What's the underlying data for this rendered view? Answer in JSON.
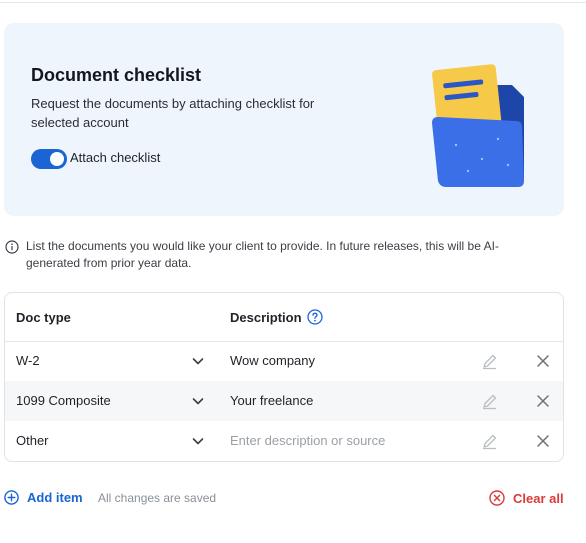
{
  "hero": {
    "title": "Document checklist",
    "description": "Request the documents by attaching checklist for selected account",
    "toggle_label": "Attach checklist",
    "toggle_on": true
  },
  "info": {
    "text": "List the documents you would like your client to provide. In future releases, this will be AI-generated from prior year data."
  },
  "table": {
    "headers": {
      "doc_type": "Doc type",
      "description": "Description"
    },
    "rows": [
      {
        "doc_type": "W-2",
        "description": "Wow company",
        "placeholder": ""
      },
      {
        "doc_type": "1099 Composite",
        "description": "Your freelance",
        "placeholder": ""
      },
      {
        "doc_type": "Other",
        "description": "",
        "placeholder": "Enter description or source"
      }
    ]
  },
  "footer": {
    "add_label": "Add item",
    "saved_status": "All changes are saved",
    "clear_label": "Clear all"
  },
  "colors": {
    "accent": "#1a64d6",
    "danger": "#d93a3a",
    "hero_bg": "#eef5fd"
  },
  "icons": [
    "folder-illustration",
    "info-icon",
    "help-icon",
    "chevron-down-icon",
    "pencil-icon",
    "close-icon",
    "plus-circle-icon",
    "clear-circle-icon"
  ]
}
